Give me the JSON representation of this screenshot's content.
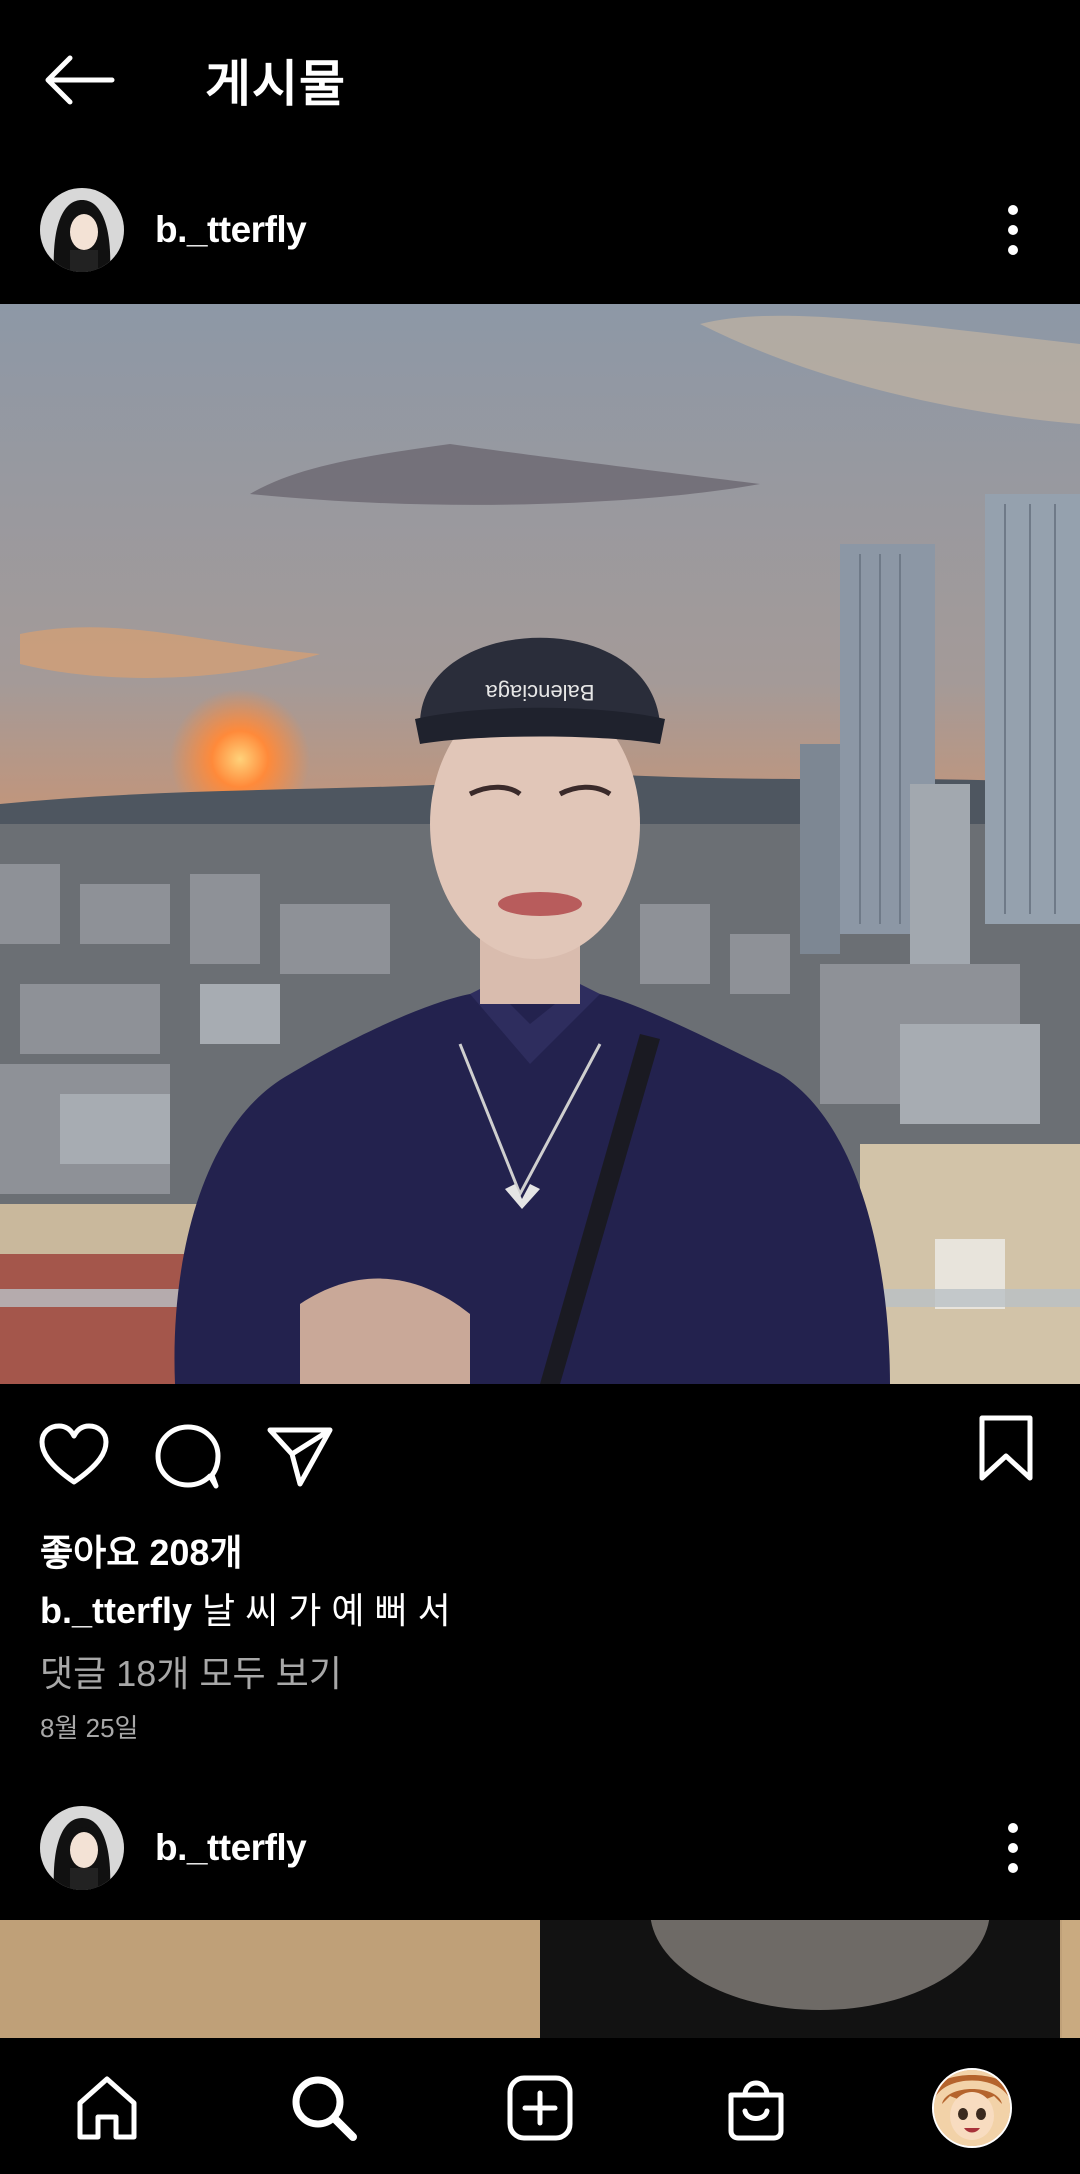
{
  "header": {
    "title": "게시물",
    "back_icon": "arrow-left-icon"
  },
  "posts": [
    {
      "username": "b._tterfly",
      "likes_text": "좋아요 208개",
      "caption_user": "b._tterfly",
      "caption_text": "날 씨 가 예 뻐 서",
      "comments_text": "댓글 18개 모두 보기",
      "date_text": "8월 25일"
    },
    {
      "username": "b._tterfly"
    }
  ],
  "actions": [
    "heart-icon",
    "comment-icon",
    "share-icon",
    "bookmark-icon"
  ],
  "bottom_nav": [
    "home-icon",
    "search-icon",
    "add-post-icon",
    "shop-icon",
    "profile-avatar"
  ],
  "colors": {
    "background": "#000000",
    "text": "#ffffff",
    "secondary_text": "#a8a8a8"
  }
}
